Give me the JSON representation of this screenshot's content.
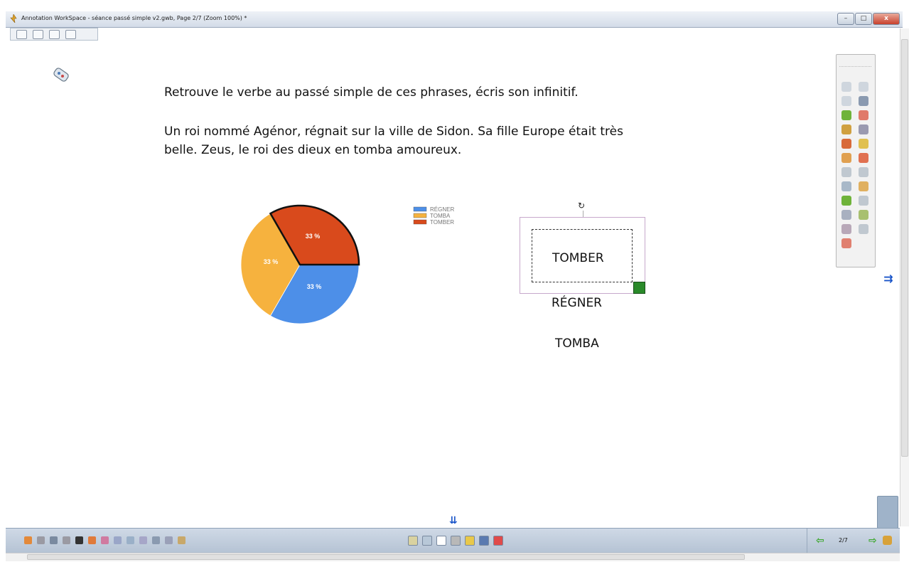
{
  "window": {
    "title": "Annotation WorkSpace - séance passé simple v2.gwb, Page 2/7  (Zoom 100%) *",
    "minimize": "–",
    "maximize": "□",
    "close": "x"
  },
  "content": {
    "instruction": "Retrouve le verbe au passé simple de ces phrases, écris son infinitif.",
    "sentence_line1": "Un roi nommé Agénor, régnait sur la ville de Sidon. Sa fille Europe était très",
    "sentence_line2": "belle. Zeus, le roi des dieux en tomba amoureux."
  },
  "chart_data": {
    "type": "pie",
    "categories": [
      "RÉGNER",
      "TOMBA",
      "TOMBER"
    ],
    "values": [
      33,
      33,
      33
    ],
    "labels": [
      "33 %",
      "33 %",
      "33 %"
    ],
    "colors": [
      "#4d8fe8",
      "#f6b23e",
      "#d94a1c"
    ],
    "legend": "right",
    "title": ""
  },
  "words": {
    "selected": "TOMBER",
    "word2": "RÉGNER",
    "word3": "TOMBA"
  },
  "icons": {
    "rotate": "↻",
    "arrows_right": "⇉",
    "arrows_down": "⇊",
    "page_back": "⇦",
    "page_next": "⇨"
  },
  "pager": {
    "page": "2/7"
  },
  "bottom_toolbar": {
    "left_colors": [
      "#e3893a",
      "#9a9aa3",
      "#7a8aa0",
      "#9a9aa3",
      "#333",
      "#e07a3a",
      "#d07aa0",
      "#9aa6c8",
      "#9ab0c8",
      "#a6a6c8",
      "#8a9ab0",
      "#9aa0b8",
      "#c8a86a"
    ],
    "center_colors": [
      "#d9d2a0",
      "#b8c8d8",
      "#ffffff",
      "#b8b8b8",
      "#e8c84a",
      "#5a7ab0",
      "#e04a4a"
    ]
  },
  "side_toolbar": {
    "colors": [
      "#cfd6de",
      "#cfd6de",
      "#cfd6de",
      "#8a9ab0",
      "#6fb33a",
      "#e07a6a",
      "#d0a040",
      "#9a9ab0",
      "#d86a3a",
      "#e0c050",
      "#e0a050",
      "#e07050",
      "#c0c8d0",
      "#c0c8d0",
      "#a8b8c8",
      "#e0b060",
      "#6fb33a",
      "#c0c8d0",
      "#a8b0c0",
      "#a8c070",
      "#b8a8b8",
      "#c0c8d0",
      "#e08070"
    ]
  }
}
